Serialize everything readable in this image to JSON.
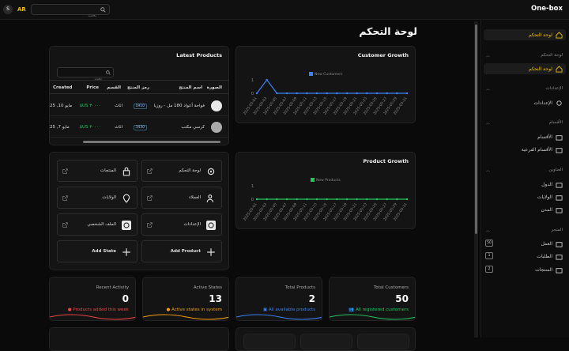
{
  "topbar": {
    "brand": "One-box",
    "lang": "AR",
    "avatar": "S",
    "search_placeholder": "بحث"
  },
  "page_title": "لوحة التحكم",
  "sidebar": {
    "top_item": "لوحة التحكم",
    "groups": [
      {
        "label": "لوحة التحكم",
        "items": [
          {
            "label": "لوحة التحكم",
            "icon": "home-icon",
            "active": true
          }
        ]
      },
      {
        "label": "الإعدادات",
        "items": [
          {
            "label": "الإعدادات",
            "icon": "settings-icon"
          }
        ]
      },
      {
        "label": "الأقسام",
        "items": [
          {
            "label": "الأقسام",
            "icon": "folder-icon"
          },
          {
            "label": "الأقسام الفرعية",
            "icon": "folder-icon"
          }
        ]
      },
      {
        "label": "العناوين",
        "items": [
          {
            "label": "الدول",
            "icon": "folder-icon"
          },
          {
            "label": "الولايات",
            "icon": "folder-icon"
          },
          {
            "label": "المدن",
            "icon": "folder-icon"
          }
        ]
      },
      {
        "label": "المتجر",
        "items": [
          {
            "label": "العمل",
            "icon": "folder-icon",
            "badge": "50"
          },
          {
            "label": "الطلبات",
            "icon": "folder-icon",
            "badge": "1"
          },
          {
            "label": "المنتجات",
            "icon": "folder-icon",
            "badge": "2"
          }
        ]
      }
    ]
  },
  "latest_products": {
    "title": "Latest Products",
    "search_placeholder": "بحث",
    "columns": [
      "الصورة",
      "اسم المنتج",
      "رمز المنتج",
      "القسم",
      "Price",
      "Created"
    ],
    "rows": [
      {
        "name": "فواحة أعواد 180 مل - روزيا",
        "code": "1910",
        "category": "اثاث",
        "price": "$US ٣٠٠٠٠",
        "created": "مايو 10, 25"
      },
      {
        "name": "كرسي مكتب",
        "code": "3430",
        "category": "اثاث",
        "price": "$US ٣٠٠٠٠",
        "created": "مايو 7, 25"
      }
    ]
  },
  "customer_growth": {
    "title": "Customer Growth",
    "legend": "New Customers",
    "color": "#3b82f6"
  },
  "product_growth": {
    "title": "Product Growth",
    "legend": "New Products",
    "color": "#22c55e"
  },
  "chart_data": [
    {
      "type": "line",
      "title": "Customer Growth",
      "x": [
        "2025-05-01",
        "2025-05-03",
        "2025-05-05",
        "2025-05-07",
        "2025-05-09",
        "2025-05-11",
        "2025-05-13",
        "2025-05-15",
        "2025-05-17",
        "2025-05-19",
        "2025-05-21",
        "2025-05-23",
        "2025-05-25",
        "2025-05-27",
        "2025-05-29",
        "2025-05-31"
      ],
      "series": [
        {
          "name": "New Customers",
          "values": [
            0,
            1,
            0,
            0,
            0,
            0,
            0,
            0,
            0,
            0,
            0,
            0,
            0,
            0,
            0,
            0
          ]
        }
      ],
      "ylim": [
        0,
        1
      ]
    },
    {
      "type": "line",
      "title": "Product Growth",
      "x": [
        "2025-05-01",
        "2025-05-03",
        "2025-05-05",
        "2025-05-07",
        "2025-05-09",
        "2025-05-11",
        "2025-05-13",
        "2025-05-15",
        "2025-05-17",
        "2025-05-19",
        "2025-05-21",
        "2025-05-23",
        "2025-05-25",
        "2025-05-27",
        "2025-05-29",
        "2025-05-31"
      ],
      "series": [
        {
          "name": "New Products",
          "values": [
            0,
            0,
            0,
            0,
            0,
            0,
            0,
            0,
            0,
            0,
            0,
            0,
            0,
            0,
            0,
            0
          ]
        }
      ],
      "ylim": [
        0,
        1
      ]
    }
  ],
  "quick_actions": [
    {
      "label": "لوحة التحكم",
      "icon": "gear-icon"
    },
    {
      "label": "المنتجات",
      "icon": "bag-icon"
    },
    {
      "label": "العملاء",
      "icon": "users-icon"
    },
    {
      "label": "الولايات",
      "icon": "pin-icon"
    },
    {
      "label": "الإعدادات",
      "icon": "gear-icon"
    },
    {
      "label": "الملف الشخصي",
      "icon": "gear-icon"
    },
    {
      "label": "Add Product",
      "icon": "plus-icon"
    },
    {
      "label": "Add State",
      "icon": "plus-icon"
    }
  ],
  "stats": [
    {
      "title": "Total Customers",
      "value": "50",
      "sub": "All registered customers",
      "color": "#22c55e"
    },
    {
      "title": "Total Products",
      "value": "2",
      "sub": "All available products",
      "color": "#3b82f6"
    },
    {
      "title": "Active States",
      "value": "13",
      "sub": "Active states in system",
      "color": "#f59e0b"
    },
    {
      "title": "Recent Activity",
      "value": "0",
      "sub": "Products added this week",
      "color": "#ef4444"
    }
  ]
}
